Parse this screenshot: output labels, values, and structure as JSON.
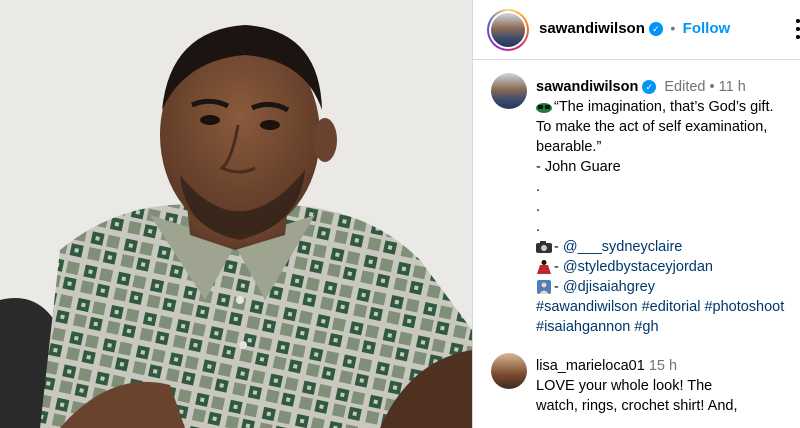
{
  "post": {
    "author": "sawandiwilson",
    "follow_label": "Follow",
    "dot": "•"
  },
  "caption": {
    "author": "sawandiwilson",
    "edited": "Edited",
    "time": "11 h",
    "lines": [
      "“The imagination, that’s God’s gift.",
      "To make the act of self examination,",
      "bearable.”",
      "- John Guare",
      ".",
      ".",
      "."
    ],
    "credits": [
      {
        "icon": "camera-icon",
        "prefix": "- ",
        "handle": "@___sydneyclaire"
      },
      {
        "icon": "dress-icon",
        "prefix": "- ",
        "handle": "@styledbystaceyjordan"
      },
      {
        "icon": "user-icon",
        "prefix": "- ",
        "handle": "@djisaiahgrey"
      }
    ],
    "hashtags_line1": "#sawandiwilson #editorial #photoshoot",
    "hashtags_line2": "#isaiahgannon #gh"
  },
  "comment": {
    "author": "lisa_marieloca01",
    "time": "15 h",
    "lines": [
      "LOVE your whole look! The",
      "watch, rings, crochet shirt! And,"
    ]
  },
  "colors": {
    "link": "#00376b",
    "accent": "#0095f6",
    "muted": "#737373"
  }
}
